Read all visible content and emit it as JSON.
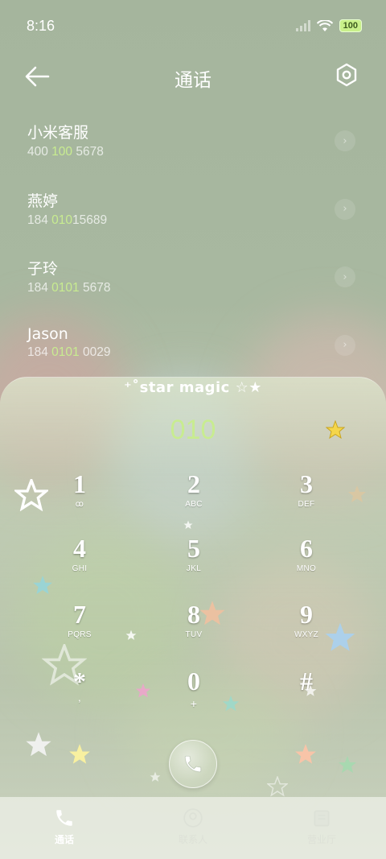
{
  "status": {
    "time": "8:16",
    "battery": "100"
  },
  "header": {
    "title": "通话"
  },
  "contacts": [
    {
      "name": "小米客服",
      "number_pre": "400 ",
      "number_hl": "100",
      "number_post": " 5678"
    },
    {
      "name": "燕婷",
      "number_pre": "184 ",
      "number_hl": "010",
      "number_post": "15689"
    },
    {
      "name": "子玲",
      "number_pre": "184 ",
      "number_hl": "0101",
      "number_post": " 5678"
    },
    {
      "name": "Jason",
      "number_pre": "184 ",
      "number_hl": "0101",
      "number_post": " 0029"
    }
  ],
  "dialer": {
    "brand": "⁺˚star magic ☆★",
    "input": "010",
    "keys": [
      {
        "digit": "1",
        "letters": "ꝏ"
      },
      {
        "digit": "2",
        "letters": "ABC"
      },
      {
        "digit": "3",
        "letters": "DEF"
      },
      {
        "digit": "4",
        "letters": "GHI"
      },
      {
        "digit": "5",
        "letters": "JKL"
      },
      {
        "digit": "6",
        "letters": "MNO"
      },
      {
        "digit": "7",
        "letters": "PQRS"
      },
      {
        "digit": "8",
        "letters": "TUV"
      },
      {
        "digit": "9",
        "letters": "WXYZ"
      },
      {
        "digit": "*",
        "letters": ","
      },
      {
        "digit": "0",
        "letters": "+"
      },
      {
        "digit": "#",
        "letters": ""
      }
    ]
  },
  "nav": [
    {
      "label": "通话",
      "icon": "phone-icon",
      "active": true
    },
    {
      "label": "联系人",
      "icon": "contacts-icon",
      "active": false
    },
    {
      "label": "营业厅",
      "icon": "store-icon",
      "active": false
    }
  ],
  "colors": {
    "accent": "#c8ec90",
    "battery": "#c9f08a"
  }
}
